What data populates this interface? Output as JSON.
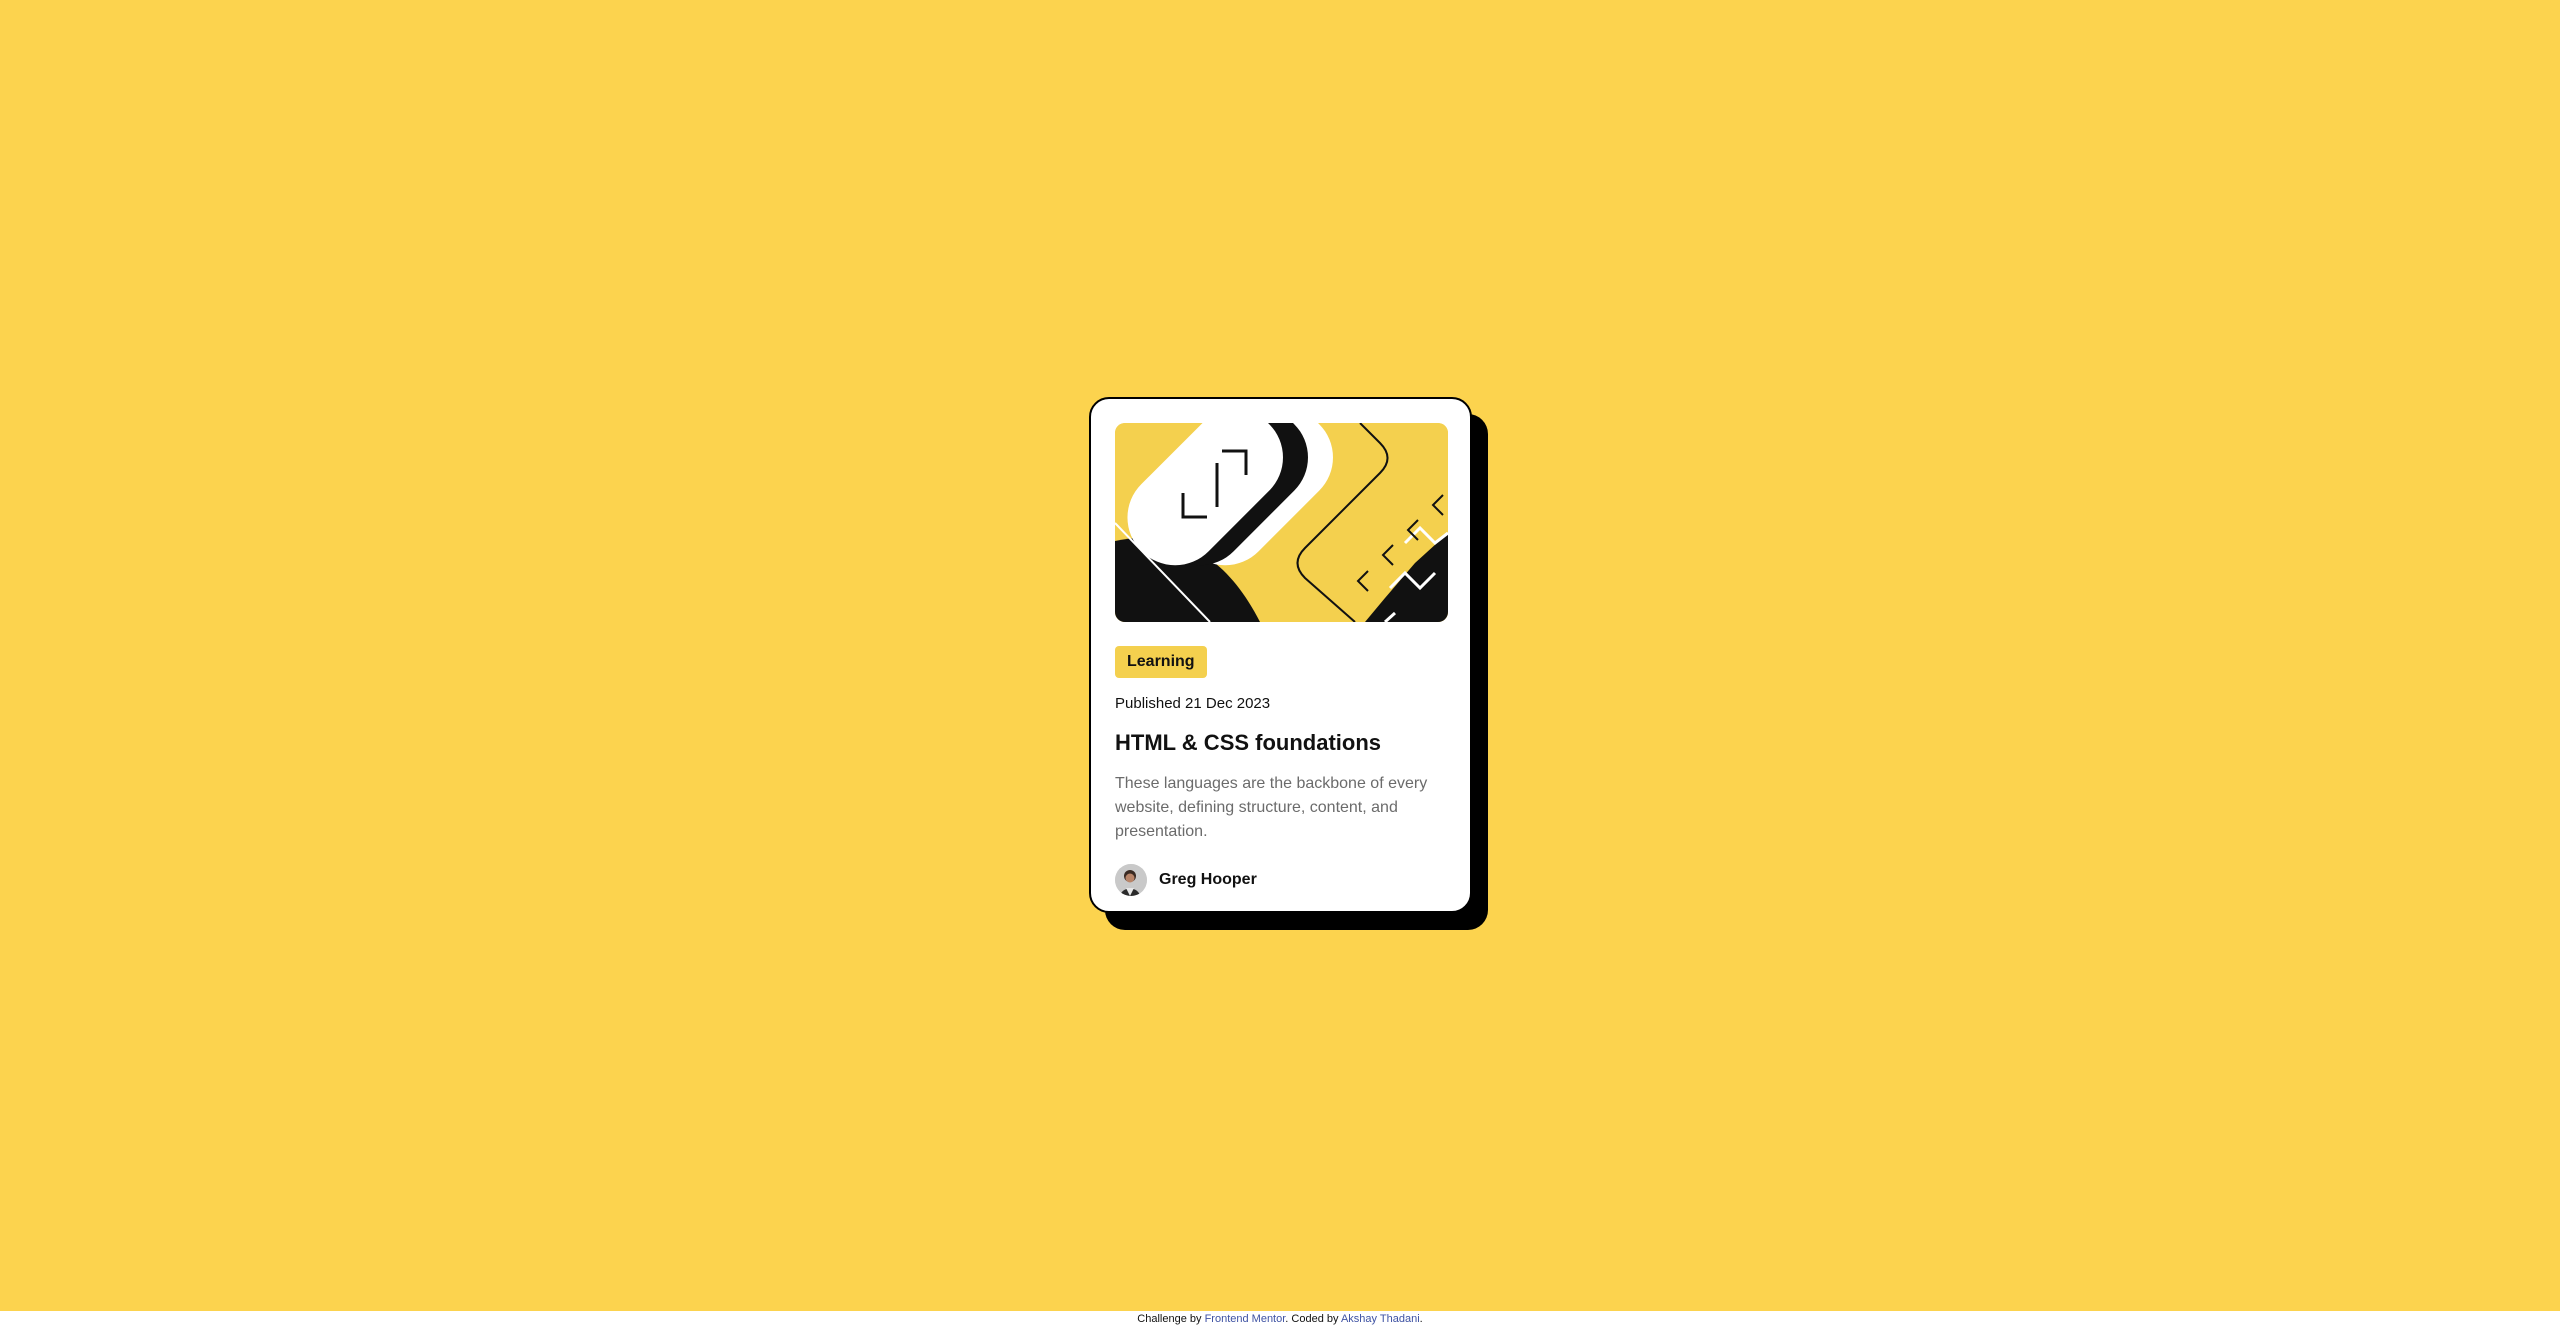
{
  "colors": {
    "background": "#FCD34E",
    "card": "#FFFFFF",
    "accent": "#F4D04E",
    "text": "#111111",
    "muted": "#6B6B6B",
    "link": "#3E52A3"
  },
  "card": {
    "hero_icon": "abstract-illustration",
    "tag": "Learning",
    "published": "Published 21 Dec 2023",
    "title": "HTML & CSS foundations",
    "description": "These languages are the backbone of every website, defining structure, content, and presentation.",
    "author": {
      "avatar_icon": "avatar-photo",
      "name": "Greg Hooper"
    }
  },
  "attribution": {
    "prefix": "Challenge by ",
    "challenge_link": "Frontend Mentor",
    "middle": ". Coded by ",
    "author_link": "Akshay Thadani",
    "suffix": "."
  }
}
